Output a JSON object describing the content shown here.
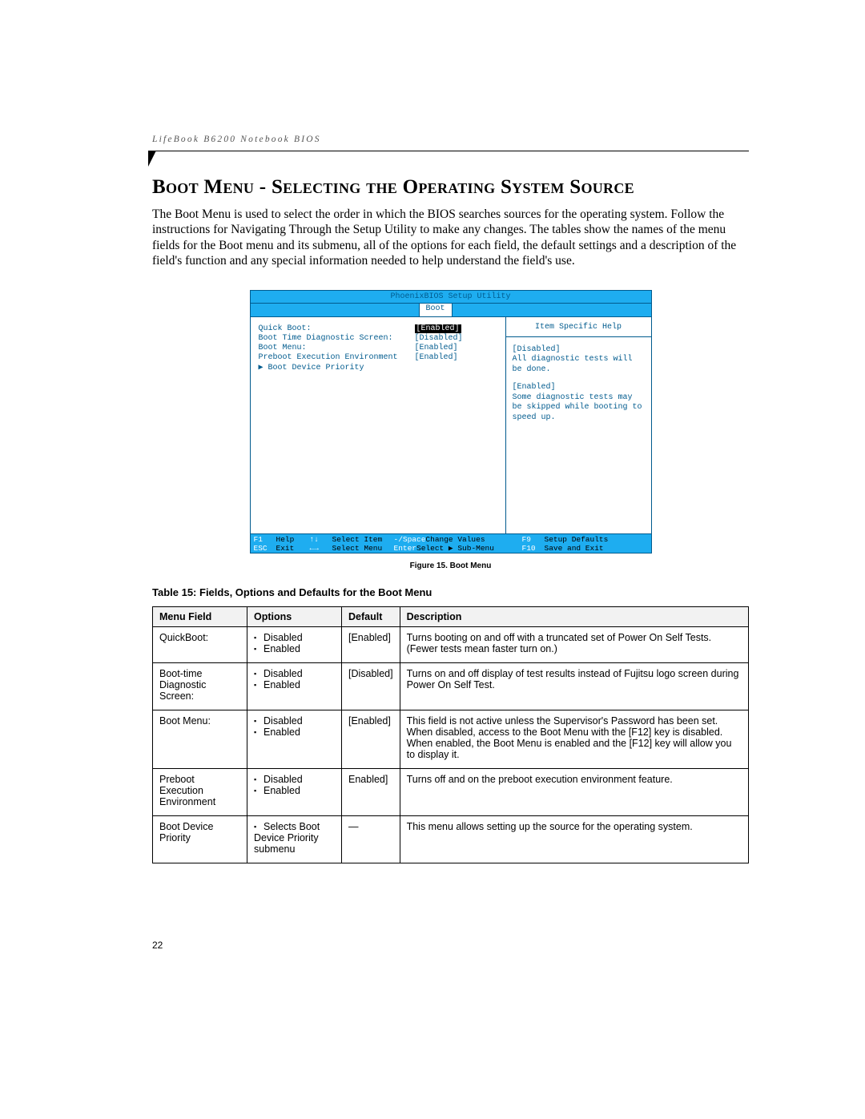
{
  "running_head": "LifeBook B6200 Notebook BIOS",
  "section_title": "Boot Menu - Selecting the Operating System Source",
  "intro": "The Boot Menu is used to select the order in which the BIOS searches sources for the operating system. Follow the instructions for Navigating Through the Setup Utility to make any changes. The tables show the names of the menu fields for the Boot menu and its submenu, all of the options for each field, the default settings and a description of the field's function and any special information needed to help understand the field's use.",
  "bios": {
    "title": "PhoenixBIOS Setup Utility",
    "tab": "Boot",
    "rows": [
      {
        "label": "Quick Boot:",
        "value": "[Enabled]",
        "selected": true
      },
      {
        "label": "Boot Time Diagnostic Screen:",
        "value": "[Disabled]"
      },
      {
        "label": "Boot Menu:",
        "value": "[Enabled]"
      },
      {
        "label": "Preboot Execution Environment",
        "value": "[Enabled]"
      },
      {
        "label": "▶ Boot Device Priority",
        "value": ""
      }
    ],
    "help_title": "Item Specific Help",
    "help_blocks": [
      "[Disabled]\nAll diagnostic tests will be done.",
      "[Enabled]\nSome diagnostic tests may be skipped while booting to speed up."
    ],
    "footer": {
      "r1": [
        {
          "k": "F1",
          "l": "Help"
        },
        {
          "k": "↑↓",
          "l": "Select Item"
        },
        {
          "k": "-/Space",
          "l": "Change Values"
        },
        {
          "k": "F9",
          "l": "Setup Defaults"
        }
      ],
      "r2": [
        {
          "k": "ESC",
          "l": "Exit"
        },
        {
          "k": "←→",
          "l": "Select Menu"
        },
        {
          "k": "Enter",
          "l": "Select ▶ Sub-Menu"
        },
        {
          "k": "F10",
          "l": "Save and Exit"
        }
      ]
    }
  },
  "figure_caption": "Figure 15.  Boot Menu",
  "table_caption": "Table 15: Fields, Options and Defaults for the Boot Menu",
  "table": {
    "headers": [
      "Menu Field",
      "Options",
      "Default",
      "Description"
    ],
    "rows": [
      {
        "field": "QuickBoot:",
        "options": [
          "Disabled",
          "Enabled"
        ],
        "default": "[Enabled]",
        "desc": "Turns booting on and off with a truncated set of Power On Self Tests. (Fewer tests mean faster turn on.)"
      },
      {
        "field": "Boot-time Diagnostic Screen:",
        "options": [
          "Disabled",
          "Enabled"
        ],
        "default": "[Disabled]",
        "desc": "Turns on and off display of test results instead of Fujitsu logo screen during Power On Self Test."
      },
      {
        "field": "Boot Menu:",
        "options": [
          "Disabled",
          "Enabled"
        ],
        "default": "[Enabled]",
        "desc": "This field is not active unless the Supervisor's Password has been set. When disabled, access to the Boot Menu with the [F12] key is disabled. When enabled, the Boot Menu is enabled and the [F12] key will allow you to display it."
      },
      {
        "field": "Preboot Execution Environment",
        "options": [
          "Disabled",
          "Enabled"
        ],
        "default": "Enabled]",
        "desc": "Turns off and on the preboot execution environment feature."
      },
      {
        "field": "Boot Device Priority",
        "options": [
          "Selects Boot Device Priority submenu"
        ],
        "default": "—",
        "desc": "This menu allows setting up the source for the operating system."
      }
    ]
  },
  "page_number": "22"
}
